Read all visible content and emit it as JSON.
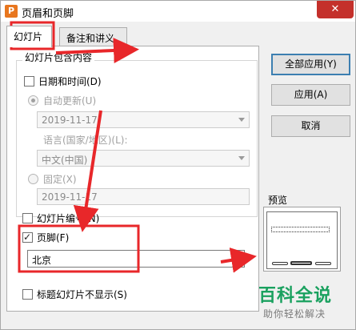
{
  "titlebar": {
    "app_icon": "P",
    "title": "页眉和页脚",
    "close_icon": "✕"
  },
  "tabs": [
    {
      "label": "幻灯片",
      "active": true
    },
    {
      "label": "备注和讲义",
      "active": false
    }
  ],
  "group": {
    "label": "幻灯片包含内容",
    "date_time": {
      "label": "日期和时间(D)",
      "checked": false
    },
    "auto_update": {
      "label": "自动更新(U)",
      "selected": true,
      "enabled": false
    },
    "auto_update_value": "2019-11-17",
    "language_label": "语言(国家/地区)(L):",
    "language_value": "中文(中国)",
    "fixed": {
      "label": "固定(X)",
      "selected": false,
      "enabled": false
    },
    "fixed_value": "2019-11-17",
    "slide_number": {
      "label": "幻灯片编号(N)",
      "checked": false
    }
  },
  "footer": {
    "label": "页脚(F)",
    "checked": true,
    "value": "北京"
  },
  "hide_on_title": {
    "label": "标题幻灯片不显示(S)",
    "checked": false
  },
  "buttons": {
    "apply_all": "全部应用(Y)",
    "apply": "应用(A)",
    "cancel": "取消"
  },
  "preview": {
    "label": "预览"
  },
  "watermark": {
    "main": "百科全说",
    "sub": "助你轻松解决"
  },
  "colors": {
    "annotation": "#e8272a",
    "close_bg": "#c4302b",
    "default_button_border": "#3c7fb1",
    "watermark": "#1aa15f"
  }
}
